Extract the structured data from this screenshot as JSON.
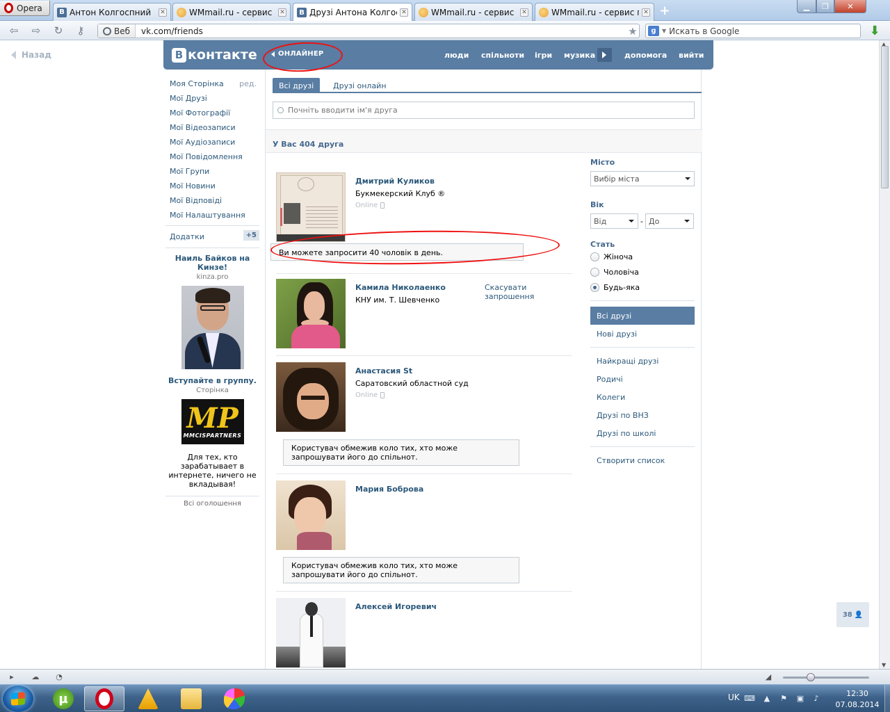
{
  "browser": {
    "opera_button": "Opera",
    "tabs": [
      {
        "title": "Антон Колгоспний",
        "favicon": "vk"
      },
      {
        "title": "WMmail.ru - сервис п...",
        "favicon": "wmmail"
      },
      {
        "title": "Друзі Антона Колгосп...",
        "favicon": "vk",
        "active": true
      },
      {
        "title": "WMmail.ru - сервис п...",
        "favicon": "wmmail"
      },
      {
        "title": "WMmail.ru - сервис п...",
        "favicon": "wmmail"
      }
    ],
    "address": {
      "badge": "Веб",
      "url": "vk.com/friends"
    },
    "search": {
      "engine": "google-icon",
      "placeholder": "Искать в Google"
    }
  },
  "page": {
    "back_link": "Назад",
    "header": {
      "logo_letter": "В",
      "logo_text": "контакте",
      "onliner": "ОНЛАЙНЕР",
      "nav": [
        "люди",
        "спільноти",
        "ігри",
        "музика",
        "допомога",
        "вийти"
      ]
    },
    "left_menu": {
      "items": [
        "Моя Сторінка",
        "Мої Друзі",
        "Мої Фотографії",
        "Мої Відеозаписи",
        "Мої Аудіозаписи",
        "Мої Повідомлення",
        "Мої Групи",
        "Мої Новини",
        "Мої Відповіді",
        "Мої Налаштування"
      ],
      "edit": "ред.",
      "addons": "Додатки",
      "addons_badge": "+5"
    },
    "ads": [
      {
        "title": "Наиль Байков на Кинзе!",
        "subtitle": "kinza.pro"
      },
      {
        "title": "Вступайте в группу.",
        "subtitle": "Сторінка",
        "logo_big": "MP",
        "logo_small": "MMCISPARTNERS",
        "text": "Для тех, кто зарабатывает в интернете, ничего не вкладывая!"
      }
    ],
    "all_ads": "Всі оголошення",
    "tabs": {
      "all": "Всі друзі",
      "online": "Друзі онлайн"
    },
    "search_placeholder": "Почніть вводити ім'я друга",
    "count_text": "У Вас 404 друга",
    "friends": [
      {
        "name": "Дмитрий Куликов",
        "info": "Букмекерский Клуб ®",
        "status": "Online"
      },
      {
        "name": "Камила Николаенко",
        "info": "КНУ им. Т. Шевченко",
        "action": "Скасувати запрошення"
      },
      {
        "name": "Анастасия St",
        "info": "Саратовский областной суд",
        "status": "Online"
      },
      {
        "name": "Мария Боброва"
      },
      {
        "name": "Алексей Игоревич"
      }
    ],
    "notices": {
      "limit": "Ви можете запросити 40 чоловік в день.",
      "restricted": "Користувач обмежив коло тих, хто може запрошувати його до спільнот."
    },
    "filters": {
      "city_label": "Місто",
      "city_value": "Вибір міста",
      "age_label": "Вік",
      "age_from": "Від",
      "age_dash": "-",
      "age_to": "До",
      "sex_label": "Стать",
      "sex_options": [
        "Жіноча",
        "Чоловіча",
        "Будь-яка"
      ],
      "sex_selected": "Будь-яка",
      "lists_main": [
        "Всі друзі",
        "Нові друзі"
      ],
      "lists_categories": [
        "Найкращі друзі",
        "Родичі",
        "Колеги",
        "Друзі по ВНЗ",
        "Друзі по школі"
      ],
      "create_list": "Створити список"
    },
    "floating_counter": "38"
  },
  "taskbar": {
    "lang": "UK",
    "time": "12:30",
    "date": "07.08.2014"
  }
}
